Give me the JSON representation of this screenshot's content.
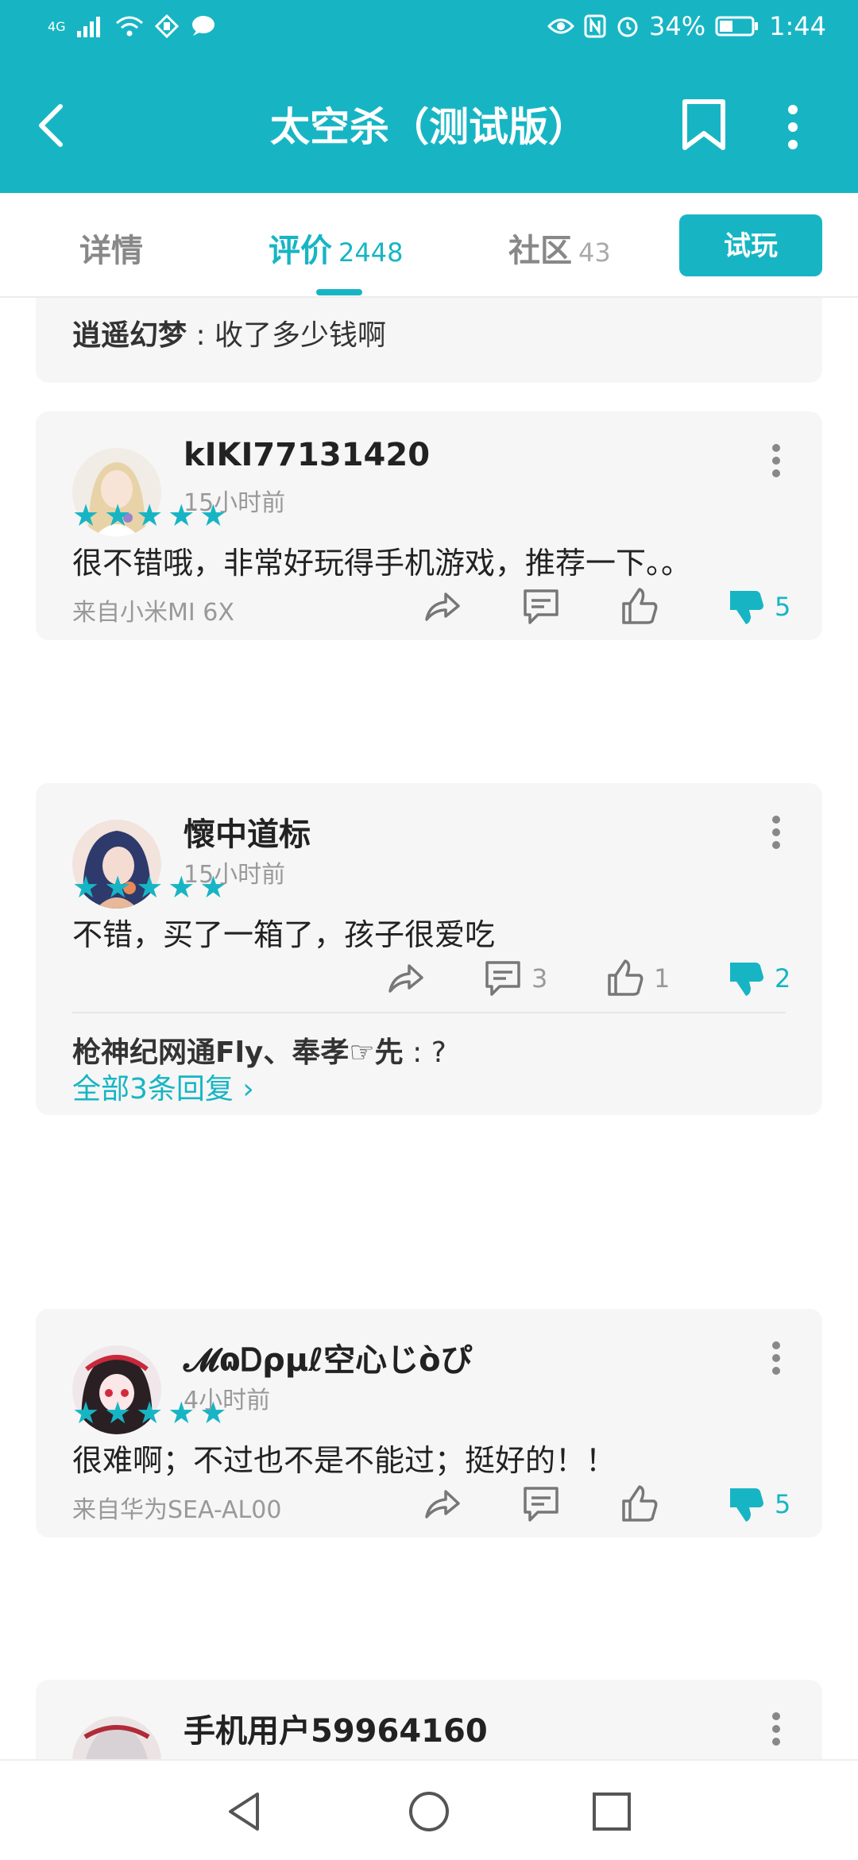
{
  "status_bar": {
    "network": "4G",
    "battery": "34%",
    "time": "1:44"
  },
  "app_bar": {
    "title": "太空杀（测试版）"
  },
  "tabs": [
    {
      "label": "详情",
      "count": ""
    },
    {
      "label": "评价",
      "count": "2448"
    },
    {
      "label": "社区",
      "count": "43"
    }
  ],
  "trial_button": "试玩",
  "partial_reply": {
    "user": "逍遥幻梦",
    "sep": " : ",
    "text": "收了多少钱啊"
  },
  "reviews": [
    {
      "user": "kIKI77131420",
      "time": "15小时前",
      "rating": 5,
      "text": "很不错哦，非常好玩得手机游戏，推荐一下。。",
      "device": "来自小米MI 6X",
      "comments": "",
      "likes": "",
      "dislikes": "5"
    },
    {
      "user": "懷中道标",
      "time": "15小时前",
      "rating": 5,
      "text": "不错，买了一箱了，孩子很爱吃",
      "device": "",
      "comments": "3",
      "likes": "1",
      "dislikes": "2",
      "reply": {
        "user": "枪神纪网通Fly、奉孝☞先",
        "sep": " : ",
        "text": "?"
      },
      "all_replies": "全部3条回复"
    },
    {
      "user": "𝓜ɷᎠρμℓ空心じòぴ",
      "time": "4小时前",
      "rating": 5,
      "text": "很难啊；不过也不是不能过；挺好的！！",
      "device": "来自华为SEA-AL00",
      "comments": "",
      "likes": "",
      "dislikes": "5"
    },
    {
      "user": "手机用户59964160"
    }
  ],
  "colors": {
    "accent": "#17b5c4",
    "card_bg": "#f6f6f6"
  }
}
